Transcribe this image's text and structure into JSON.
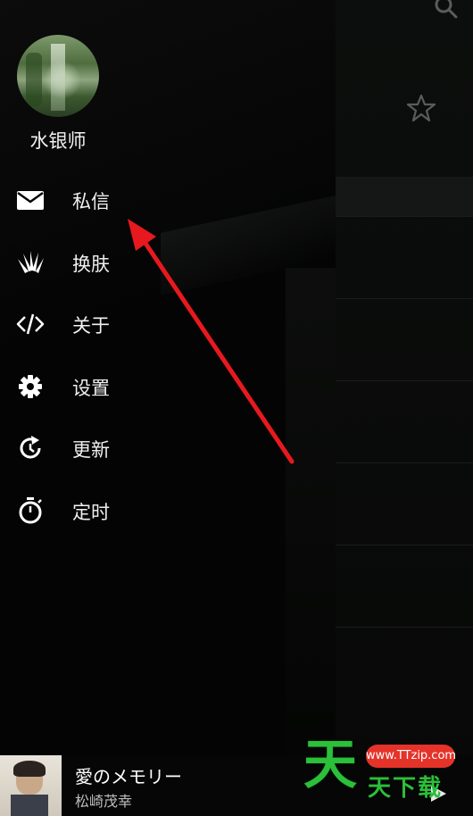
{
  "drawer": {
    "username": "水银师",
    "menu": [
      {
        "label": "私信",
        "icon": "mail-icon"
      },
      {
        "label": "换肤",
        "icon": "skin-icon"
      },
      {
        "label": "关于",
        "icon": "code-icon"
      },
      {
        "label": "设置",
        "icon": "gear-icon"
      },
      {
        "label": "更新",
        "icon": "update-icon"
      },
      {
        "label": "定时",
        "icon": "timer-icon"
      }
    ]
  },
  "header": {
    "search_icon": "search-icon",
    "favorite_icon": "star-icon"
  },
  "player": {
    "title": "愛のメモリー",
    "artist": "松崎茂幸"
  },
  "watermark": {
    "big": "天",
    "pill": "www.TTzip.com",
    "sub": "天下载"
  },
  "colors": {
    "accent_arrow": "#e8191e",
    "watermark_green": "#2bbf3a",
    "watermark_red": "#e5332a"
  }
}
